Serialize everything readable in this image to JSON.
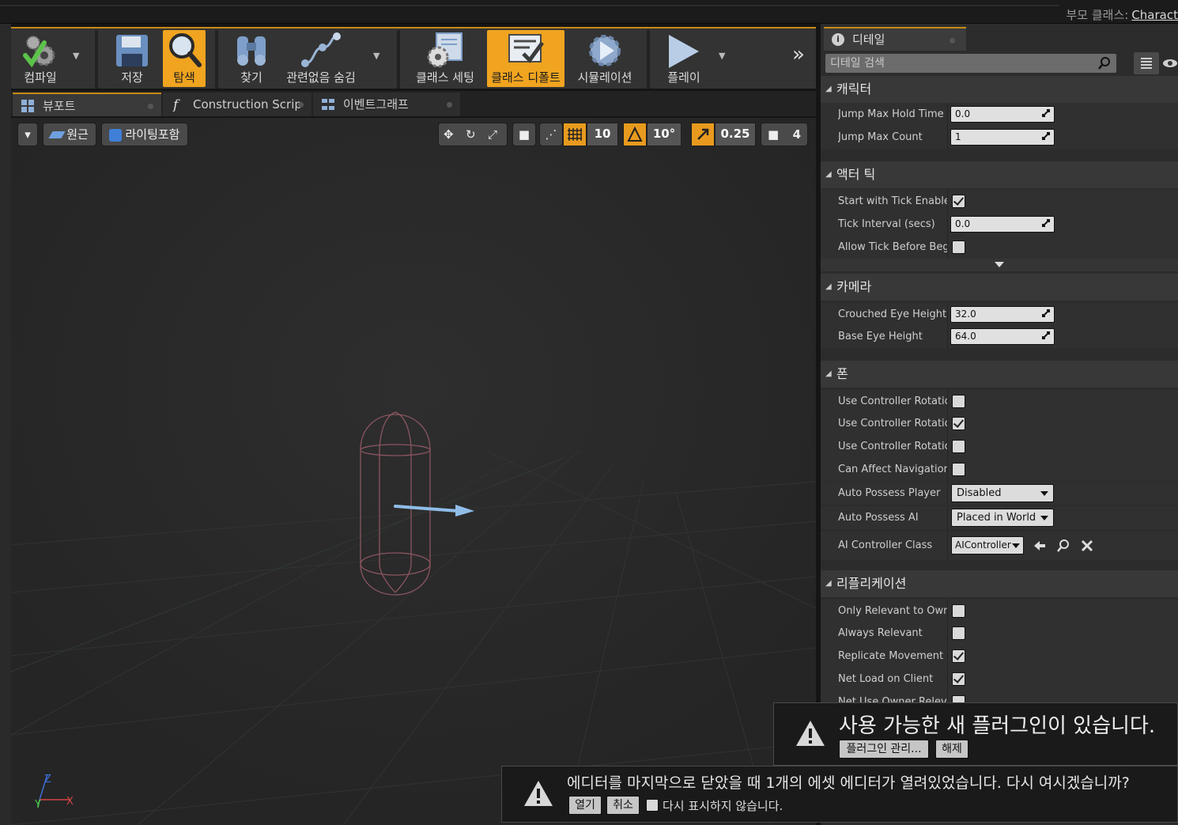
{
  "header": {
    "parent_class_label": "부모 클래스:",
    "parent_class_value": "Charact"
  },
  "toolbar": {
    "compile": {
      "label": "컴파일",
      "icon": "compile-gear-check-icon"
    },
    "save": {
      "label": "저장",
      "icon": "floppy-disk-icon"
    },
    "browse": {
      "label": "탐색",
      "icon": "magnifier-icon"
    },
    "find": {
      "label": "찾기",
      "icon": "binoculars-icon"
    },
    "hide_unrelated": {
      "label": "관련없음 숨김",
      "icon": "nodes-connection-icon"
    },
    "class_settings": {
      "label": "클래스 세팅",
      "icon": "class-settings-icon"
    },
    "class_defaults": {
      "label": "클래스 디폴트",
      "icon": "class-defaults-icon"
    },
    "simulation": {
      "label": "시뮬레이션",
      "icon": "simulation-icon"
    },
    "play": {
      "label": "플레이",
      "icon": "play-triangle-icon"
    },
    "overflow": "»"
  },
  "tabs": [
    {
      "label": "뷰포트",
      "icon": "viewport-grid-icon",
      "active": true
    },
    {
      "label": "Construction Scrip",
      "icon": "function-f-icon",
      "active": false
    },
    {
      "label": "이벤트그래프",
      "icon": "event-graph-icon",
      "active": false
    }
  ],
  "viewport_toolbar": {
    "perspective": "원근",
    "lit": "라이팅포함",
    "grid_snap": "10",
    "rotation_snap": "10°",
    "scale_snap": "0.25",
    "camera_speed": "4"
  },
  "details": {
    "tab_label": "디테일",
    "search_placeholder": "디테일 검색",
    "categories": {
      "character": "캐릭터",
      "actor_tick": "액터 틱",
      "camera": "카메라",
      "pawn": "폰",
      "replication": "리플리케이션"
    },
    "props": {
      "jump_max_hold_time": {
        "name": "Jump Max Hold Time",
        "value": "0.0"
      },
      "jump_max_count": {
        "name": "Jump Max Count",
        "value": "1"
      },
      "start_with_tick": {
        "name": "Start with Tick Enabled",
        "checked": true
      },
      "tick_interval": {
        "name": "Tick Interval (secs)",
        "value": "0.0"
      },
      "allow_tick_before_begin": {
        "name": "Allow Tick Before Begin",
        "checked": false
      },
      "crouched_eye_height": {
        "name": "Crouched Eye Height",
        "value": "32.0"
      },
      "base_eye_height": {
        "name": "Base Eye Height",
        "value": "64.0"
      },
      "use_ctrl_rot_pitch": {
        "name": "Use Controller Rotation P",
        "checked": false
      },
      "use_ctrl_rot_yaw": {
        "name": "Use Controller Rotation Y",
        "checked": true
      },
      "use_ctrl_rot_roll": {
        "name": "Use Controller Rotation R",
        "checked": false
      },
      "can_affect_nav": {
        "name": "Can Affect Navigation Ge",
        "checked": false
      },
      "auto_possess_player": {
        "name": "Auto Possess Player",
        "value": "Disabled"
      },
      "auto_possess_ai": {
        "name": "Auto Possess AI",
        "value": "Placed in World"
      },
      "ai_controller_class": {
        "name": "AI Controller Class",
        "value": "AIController"
      },
      "only_relevant_owner": {
        "name": "Only Relevant to Owner",
        "checked": false
      },
      "always_relevant": {
        "name": "Always Relevant",
        "checked": false
      },
      "replicate_movement": {
        "name": "Replicate Movement",
        "checked": true
      },
      "net_load_on_client": {
        "name": "Net Load on Client",
        "checked": true
      },
      "net_use_owner_relevancy": {
        "name": "Net Use Owner Relevancy",
        "checked": false
      }
    }
  },
  "notifications": {
    "plugins": {
      "message": "사용 가능한 새 플러그인이 있습니다.",
      "manage_button": "플러그인 관리...",
      "dismiss_button": "해제"
    },
    "reopen": {
      "message": "에디터를 마지막으로 닫았을 때 1개의 에셋 에디터가 열려있었습니다. 다시 여시겠습니까?",
      "open_button": "열기",
      "cancel_button": "취소",
      "dont_show_label": "다시 표시하지 않습니다."
    }
  }
}
